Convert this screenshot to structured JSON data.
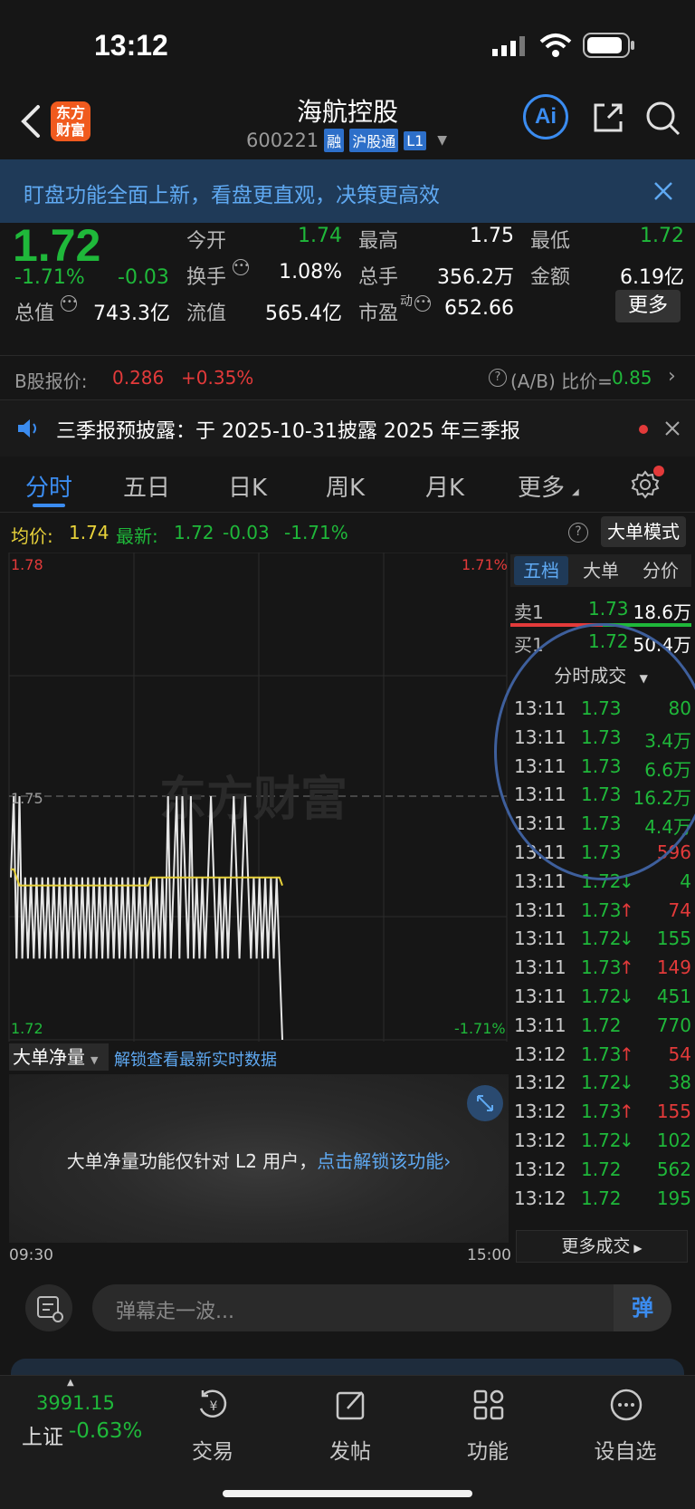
{
  "status_bar": {
    "time": "13:12"
  },
  "header": {
    "logo_line1": "东方",
    "logo_line2": "财富",
    "title": "海航控股",
    "code": "600221",
    "badges": [
      "融",
      "沪股通",
      "L1"
    ],
    "ai_label": "Ai"
  },
  "banner": {
    "text": "盯盘功能全面上新，看盘更直观，决策更高效"
  },
  "quote": {
    "price": "1.72",
    "change_pct": "-1.71%",
    "change": "-0.03",
    "total_value_label": "总值",
    "total_value": "743.3亿",
    "open_label": "今开",
    "open": "1.74",
    "high_label": "最高",
    "high": "1.75",
    "low_label": "最低",
    "low": "1.72",
    "turnover_label": "换手",
    "turnover": "1.08%",
    "volume_label": "总手",
    "volume": "356.2万",
    "amount_label": "金额",
    "amount": "6.19亿",
    "float_label": "流值",
    "float_value": "565.4亿",
    "pe_label": "市盈",
    "pe_sup": "动",
    "pe": "652.66",
    "more_button": "更多"
  },
  "b_share": {
    "label": "B股报价:",
    "price": "0.286",
    "change": "+0.35%",
    "ratio_label": "(A/B) 比价=",
    "ratio": "0.85"
  },
  "notice": {
    "text": "三季报预披露：于 2025-10-31披露 2025 年三季报"
  },
  "tabs": [
    {
      "label": "分时",
      "active": true
    },
    {
      "label": "五日"
    },
    {
      "label": "日K"
    },
    {
      "label": "周K"
    },
    {
      "label": "月K"
    },
    {
      "label": "更多"
    }
  ],
  "info_bar": {
    "avg_label": "均价:",
    "avg": "1.74",
    "latest_label": "最新:",
    "latest": "1.72",
    "change": "-0.03",
    "change_pct": "-1.71%",
    "mode_button": "大单模式"
  },
  "chart_data": {
    "type": "line",
    "y_top_label": "1.78",
    "y_mid_label": "1.75",
    "y_bottom_label": "1.72",
    "pct_top_label": "1.71%",
    "pct_bottom_label": "-1.71%",
    "x_start": "09:30",
    "x_end": "15:00",
    "ylim": [
      1.72,
      1.78
    ],
    "watermark": "东方财富",
    "series": [
      {
        "values": [
          1.74,
          1.75,
          1.73,
          1.75,
          1.73,
          1.74,
          1.73,
          1.74,
          1.73,
          1.74,
          1.73,
          1.74,
          1.73,
          1.74,
          1.73,
          1.74,
          1.73,
          1.74,
          1.73,
          1.74,
          1.73,
          1.74,
          1.73,
          1.74,
          1.73,
          1.74,
          1.73,
          1.74,
          1.73,
          1.74,
          1.73,
          1.74,
          1.73,
          1.74,
          1.73,
          1.74,
          1.73,
          1.74,
          1.73,
          1.74,
          1.73,
          1.74,
          1.73,
          1.74,
          1.73,
          1.74,
          1.73,
          1.74,
          1.73,
          1.74,
          1.73,
          1.74,
          1.73,
          1.74,
          1.73,
          1.75,
          1.73,
          1.74,
          1.75,
          1.73,
          1.75,
          1.74,
          1.73,
          1.75,
          1.73,
          1.74,
          1.73,
          1.74,
          1.73,
          1.74,
          1.75,
          1.74,
          1.73,
          1.74,
          1.73,
          1.74,
          1.73,
          1.74,
          1.75,
          1.74,
          1.73,
          1.74,
          1.75,
          1.74,
          1.73,
          1.74,
          1.73,
          1.74,
          1.73,
          1.74,
          1.73,
          1.74,
          1.73,
          1.74,
          1.73,
          1.72
        ]
      },
      {
        "values": [
          1.741,
          1.741,
          1.74,
          1.739,
          1.739,
          1.739,
          1.739,
          1.739,
          1.739,
          1.739,
          1.739,
          1.739,
          1.739,
          1.739,
          1.739,
          1.739,
          1.739,
          1.739,
          1.739,
          1.739,
          1.739,
          1.739,
          1.739,
          1.739,
          1.739,
          1.739,
          1.739,
          1.739,
          1.739,
          1.739,
          1.739,
          1.739,
          1.739,
          1.739,
          1.739,
          1.739,
          1.739,
          1.739,
          1.739,
          1.739,
          1.739,
          1.739,
          1.739,
          1.739,
          1.739,
          1.739,
          1.739,
          1.739,
          1.739,
          1.74,
          1.74,
          1.74,
          1.74,
          1.74,
          1.74,
          1.74,
          1.74,
          1.74,
          1.74,
          1.74,
          1.74,
          1.74,
          1.74,
          1.74,
          1.74,
          1.74,
          1.74,
          1.74,
          1.74,
          1.74,
          1.74,
          1.74,
          1.74,
          1.74,
          1.74,
          1.74,
          1.74,
          1.74,
          1.74,
          1.74,
          1.74,
          1.74,
          1.74,
          1.74,
          1.74,
          1.74,
          1.74,
          1.74,
          1.74,
          1.74,
          1.74,
          1.74,
          1.74,
          1.74,
          1.74,
          1.739
        ]
      }
    ]
  },
  "side_tabs": [
    "五档",
    "大单",
    "分价"
  ],
  "order_book": [
    {
      "label": "卖1",
      "price": "1.73",
      "volume": "18.6万"
    },
    {
      "label": "买1",
      "price": "1.72",
      "volume": "50.4万"
    }
  ],
  "trades_header": "分时成交",
  "trades": [
    {
      "time": "13:11",
      "price": "1.73",
      "arrow": "",
      "vol": "80",
      "color": "#1fb83a"
    },
    {
      "time": "13:11",
      "price": "1.73",
      "arrow": "",
      "vol": "3.4万",
      "color": "#1fb83a"
    },
    {
      "time": "13:11",
      "price": "1.73",
      "arrow": "",
      "vol": "6.6万",
      "color": "#1fb83a"
    },
    {
      "time": "13:11",
      "price": "1.73",
      "arrow": "",
      "vol": "16.2万",
      "color": "#1fb83a"
    },
    {
      "time": "13:11",
      "price": "1.73",
      "arrow": "",
      "vol": "4.4万",
      "color": "#1fb83a"
    },
    {
      "time": "13:11",
      "price": "1.73",
      "arrow": "",
      "vol": "596",
      "color": "#e33a3a"
    },
    {
      "time": "13:11",
      "price": "1.72",
      "arrow": "↓",
      "vol": "4",
      "color": "#1fb83a"
    },
    {
      "time": "13:11",
      "price": "1.73",
      "arrow": "↑",
      "vol": "74",
      "color": "#e33a3a"
    },
    {
      "time": "13:11",
      "price": "1.72",
      "arrow": "↓",
      "vol": "155",
      "color": "#1fb83a"
    },
    {
      "time": "13:11",
      "price": "1.73",
      "arrow": "↑",
      "vol": "149",
      "color": "#e33a3a"
    },
    {
      "time": "13:11",
      "price": "1.72",
      "arrow": "↓",
      "vol": "451",
      "color": "#1fb83a"
    },
    {
      "time": "13:11",
      "price": "1.72",
      "arrow": "",
      "vol": "770",
      "color": "#1fb83a"
    },
    {
      "time": "13:12",
      "price": "1.73",
      "arrow": "↑",
      "vol": "54",
      "color": "#e33a3a"
    },
    {
      "time": "13:12",
      "price": "1.72",
      "arrow": "↓",
      "vol": "38",
      "color": "#1fb83a"
    },
    {
      "time": "13:12",
      "price": "1.73",
      "arrow": "↑",
      "vol": "155",
      "color": "#e33a3a"
    },
    {
      "time": "13:12",
      "price": "1.72",
      "arrow": "↓",
      "vol": "102",
      "color": "#1fb83a"
    },
    {
      "time": "13:12",
      "price": "1.72",
      "arrow": "",
      "vol": "562",
      "color": "#1fb83a"
    },
    {
      "time": "13:12",
      "price": "1.72",
      "arrow": "",
      "vol": "195",
      "color": "#1fb83a"
    }
  ],
  "more_trades": "更多成交",
  "net_volume": {
    "selector": "大单净量",
    "unlock_link": "解锁查看最新实时数据",
    "panel_text": "大单净量功能仅针对 L2 用户，",
    "panel_link": "点击解锁该功能"
  },
  "danmu": {
    "placeholder": "弹幕走一波...",
    "send_label": "弹"
  },
  "bottom_nav": {
    "index_value": "3991.15",
    "index_name": "上证",
    "index_change": "-0.63%",
    "items": [
      "交易",
      "发帖",
      "功能",
      "设自选"
    ]
  },
  "colors": {
    "up": "#e33a3a",
    "down": "#1fb83a",
    "accent": "#3b8cf0",
    "avg_line": "#e8d23a"
  }
}
